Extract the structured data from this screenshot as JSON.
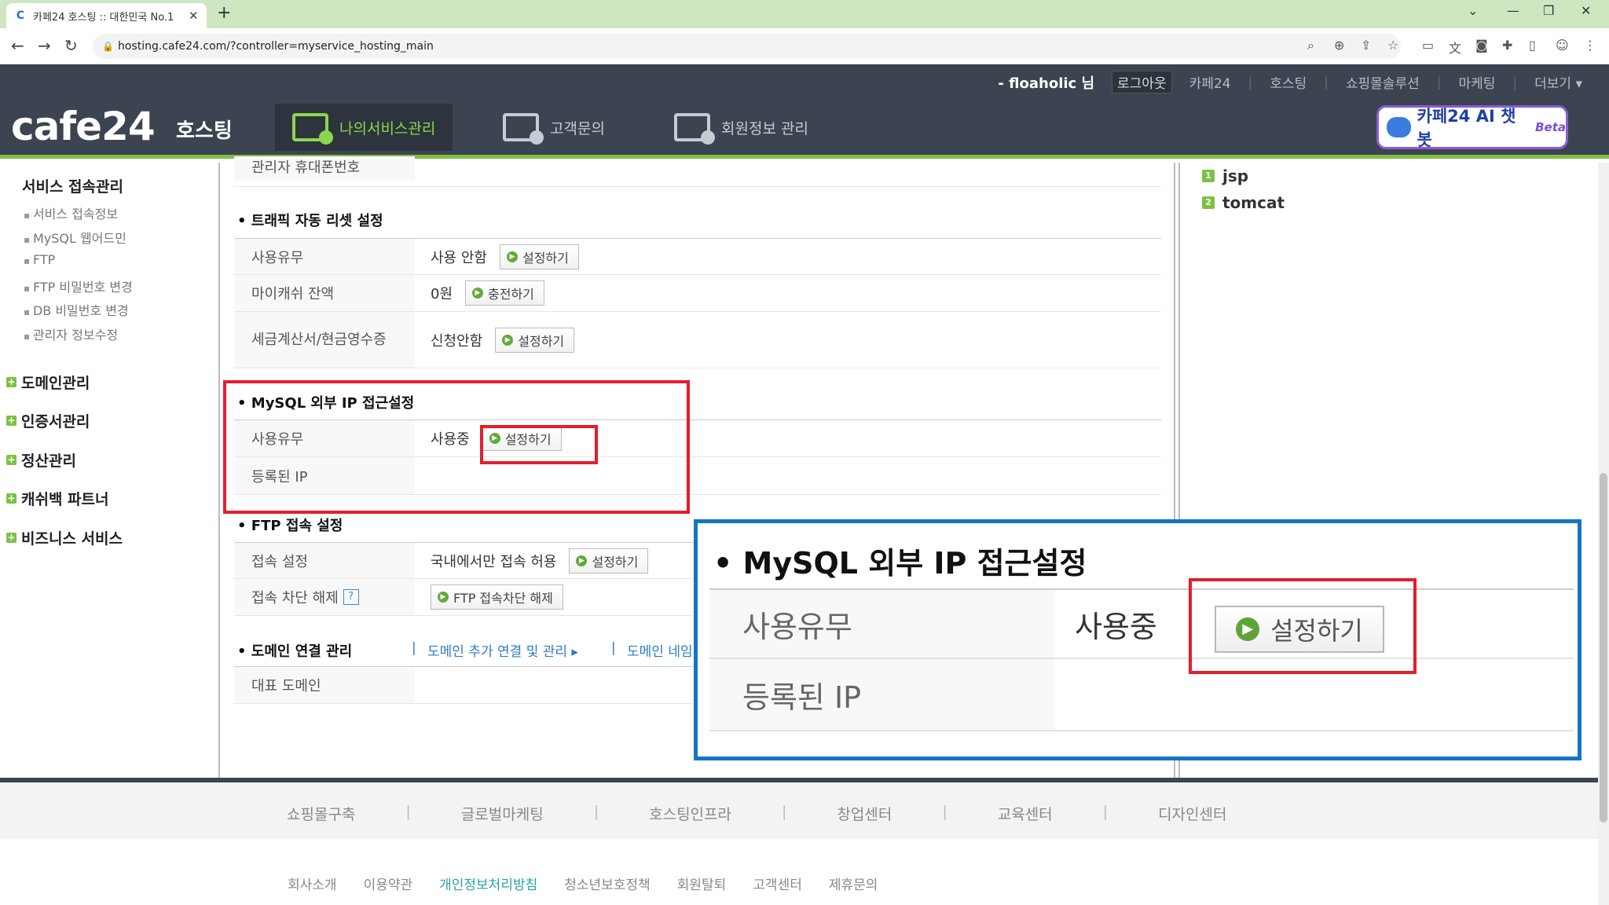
{
  "browser": {
    "tab_title": "카페24 호스팅 :: 대한민국 No.1",
    "url": "hosting.cafe24.com/?controller=myservice_hosting_main"
  },
  "topbar": {
    "user": "- floaholic 님",
    "logout": "로그아웃",
    "links": [
      "카페24",
      "호스팅",
      "쇼핑몰솔루션",
      "마케팅",
      "더보기 ▾"
    ]
  },
  "header": {
    "logo": "cafe24",
    "logo_sub": "호스팅",
    "menus": [
      "나의서비스관리",
      "고객문의",
      "회원정보 관리"
    ],
    "chatbot": "카페24 AI 챗봇",
    "chatbot_badge": "Beta"
  },
  "sidebar": {
    "section_title": "서비스 접속관리",
    "sub_items": [
      "서비스 접속정보",
      "MySQL 웹어드민",
      "FTP",
      "FTP 비밀번호 변경",
      "DB 비밀번호 변경",
      "관리자 정보수정"
    ],
    "main_items": [
      "도메인관리",
      "인증서관리",
      "정산관리",
      "캐쉬백 파트너",
      "비즈니스 서비스"
    ]
  },
  "content": {
    "partial_row_label": "관리자 휴대폰번호",
    "traffic": {
      "title": "트래픽 자동 리셋 설정",
      "rows": [
        {
          "label": "사용유무",
          "value": "사용 안함",
          "button": "설정하기"
        },
        {
          "label": "마이캐쉬 잔액",
          "value": "0원",
          "button": "충전하기"
        },
        {
          "label": "세금계산서/현금영수증",
          "value": "신청안함",
          "button": "설정하기"
        }
      ]
    },
    "mysql": {
      "title": "MySQL 외부 IP 접근설정",
      "usage_label": "사용유무",
      "usage_value": "사용중",
      "button": "설정하기",
      "ip_label": "등록된 IP",
      "ip_value": ""
    },
    "ftp": {
      "title": "FTP 접속 설정",
      "access_label": "접속 설정",
      "access_value": "국내에서만 접속 허용",
      "access_button": "설정하기",
      "unblock_label": "접속 차단 해제",
      "help": "?",
      "unblock_button": "FTP 접속차단 해제"
    },
    "domain": {
      "title": "도메인 연결 관리",
      "link1": "도메인 추가 연결 및 관리",
      "link2": "도메인 네임",
      "rep_label": "대표 도메인"
    }
  },
  "right_panel": {
    "items": [
      {
        "num": "1",
        "label": "jsp"
      },
      {
        "num": "2",
        "label": "tomcat"
      }
    ]
  },
  "footer": {
    "top_links": [
      "쇼핑몰구축",
      "글로벌마케팅",
      "호스팅인프라",
      "창업센터",
      "교육센터",
      "디자인센터"
    ],
    "bottom_links": [
      "회사소개",
      "이용약관",
      "개인정보처리방침",
      "청소년보호정책",
      "회원탈퇴",
      "고객센터",
      "제휴문의"
    ]
  },
  "colors": {
    "header_bg": "#3b4450",
    "accent_green": "#7fbf3f",
    "highlight_red": "#e41e2a",
    "zoom_blue": "#1673c5"
  }
}
